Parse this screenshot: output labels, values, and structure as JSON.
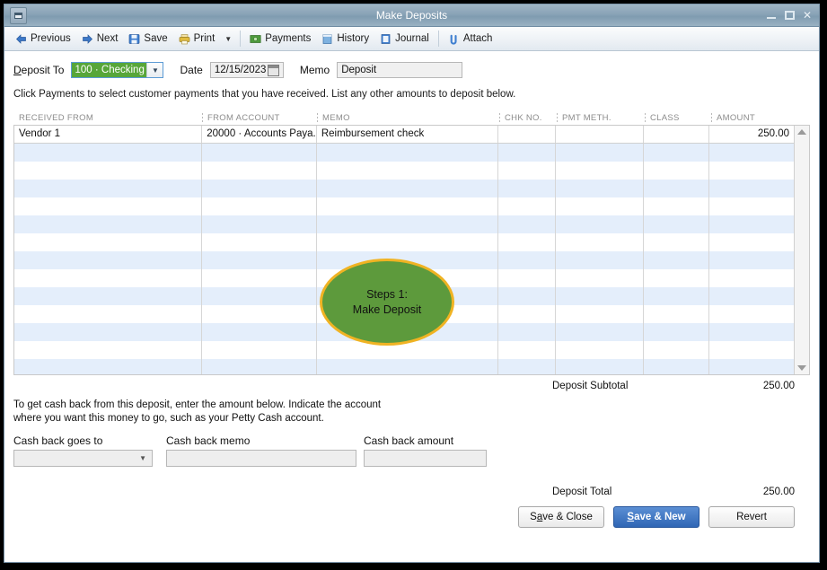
{
  "window": {
    "title": "Make Deposits",
    "sysmenu_icon": "window-restore-icon",
    "minimize_label": "–",
    "maximize_label": "",
    "close_label": "✕"
  },
  "toolbar": {
    "items": [
      {
        "label": "Previous",
        "icon": "arrow-left-icon"
      },
      {
        "label": "Next",
        "icon": "arrow-right-icon"
      },
      {
        "label": "Save",
        "icon": "save-disk-icon"
      },
      {
        "label": "Print",
        "icon": "printer-icon"
      }
    ],
    "print_caret": "▼",
    "items2": [
      {
        "label": "Payments",
        "icon": "payments-icon"
      },
      {
        "label": "History",
        "icon": "history-icon"
      },
      {
        "label": "Journal",
        "icon": "journal-icon"
      }
    ],
    "items3": [
      {
        "label": "Attach",
        "icon": "paperclip-icon"
      }
    ]
  },
  "form": {
    "deposit_to_label": "Deposit To",
    "deposit_to_value": "100 · Checking",
    "deposit_to_caret": "▼",
    "date_label": "Date",
    "date_value": "12/15/2023",
    "memo_label": "Memo",
    "memo_value": "Deposit",
    "instruction": "Click Payments to select customer payments that you have received. List any other amounts to deposit below."
  },
  "grid": {
    "columns": [
      "RECEIVED FROM",
      "FROM ACCOUNT",
      "MEMO",
      "CHK NO.",
      "PMT METH.",
      "CLASS",
      "AMOUNT"
    ],
    "rows": [
      {
        "received_from": "Vendor 1",
        "from_account": "20000 · Accounts Paya...",
        "memo": "Reimbursement check",
        "chk_no": "",
        "pmt_meth": "",
        "class": "",
        "amount": "250.00"
      }
    ],
    "empty_row_count": 13,
    "scroll_up_icon": "scroll-up-arrow-icon",
    "scroll_down_icon": "scroll-down-arrow-icon"
  },
  "totals": {
    "subtotal_label": "Deposit Subtotal",
    "subtotal_value": "250.00",
    "total_label": "Deposit Total",
    "total_value": "250.00"
  },
  "cashback": {
    "description_line1": "To get cash back from this deposit, enter the amount below.  Indicate the account",
    "description_line2": "where you want this money to go, such as your Petty Cash account.",
    "goes_to_label": "Cash back goes to",
    "goes_to_value": "",
    "goes_to_caret": "▼",
    "memo_label": "Cash back memo",
    "memo_value": "",
    "amount_label": "Cash back amount",
    "amount_value": ""
  },
  "buttons": {
    "save_close": "Save & Close",
    "save_new": "Save & New",
    "revert": "Revert"
  },
  "annotation": {
    "line1": "Steps 1:",
    "line2": "Make Deposit",
    "fill_color": "#5d9a3c",
    "border_color": "#f0b323"
  }
}
